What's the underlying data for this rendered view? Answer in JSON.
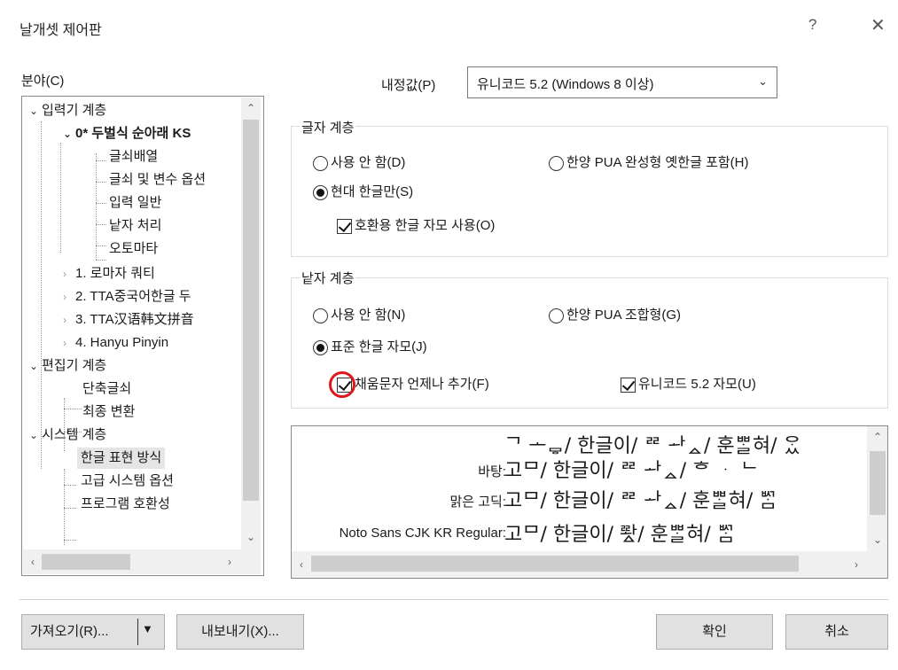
{
  "window": {
    "title": "날개셋 제어판",
    "help": "?",
    "close": "✕"
  },
  "tree": {
    "label": "분야(C)",
    "items": [
      "입력기 계층",
      "0* 두벌식 순아래 KS",
      "글쇠배열",
      "글쇠 및 변수 옵션",
      "입력 일반",
      "낱자 처리",
      "오토마타",
      "1. 로마자 쿼티",
      "2. TTA중국어한글 두",
      "3. TTA汉语韩文拼音",
      "4. Hanyu Pinyin",
      "편집기 계층",
      "단축글쇠",
      "최종 변환",
      "시스템 계층",
      "한글 표현 방식",
      "고급 시스템 옵션",
      "프로그램 호환성"
    ],
    "selected": "한글 표현 방식"
  },
  "default": {
    "label": "내정값(P)",
    "value": "유니코드 5.2 (Windows 8 이상)"
  },
  "char_layer": {
    "title": "글자 계층",
    "options": {
      "none": "사용 안 함(D)",
      "pua_full": "한양 PUA 완성형 옛한글 포함(H)",
      "modern_only": "현대 한글만(S)"
    },
    "selected": "modern_only",
    "compat_jamo": {
      "label": "호환용 한글 자모 사용(O)",
      "checked": true
    }
  },
  "jamo_layer": {
    "title": "낱자 계층",
    "options": {
      "none": "사용 안 함(N)",
      "pua_combo": "한양 PUA 조합형(G)",
      "standard": "표준 한글 자모(J)"
    },
    "selected": "standard",
    "fill_always": {
      "label": "채움문자 언제나 추가(F)",
      "checked": true
    },
    "unicode52": {
      "label": "유니코드 5.2 자모(U)",
      "checked": true
    }
  },
  "preview": {
    "rows": [
      {
        "label": "",
        "sample": "ᄀ ᅩᇢ/ 한글이/ ᄙ ᅪᇫ/ 훈ᄈᆞᆯ혀/ ᄋᆞᆻ"
      },
      {
        "label": "바탕:",
        "sample": "고ᄆ/ 한글이/ ᄙ    ᅪᇫ/ ᄒ ᆞ ᄂ"
      },
      {
        "label": "맑은 고딕:",
        "sample": "고ᄆ/ 한글이/ ᄙ ᅪᇫ/ 훈ᄈᆞᆯ혀/ ᄢᆞᆷ"
      },
      {
        "label": "Noto Sans CJK KR Regular:",
        "sample": "고ᄆ/ 한글이/ ᄙᅪᇫ/ 훈ᄈᆞᆯ혀/ ᄢᆞᆷ"
      }
    ]
  },
  "buttons": {
    "import": "가져오기(R)...",
    "export": "내보내기(X)...",
    "ok": "확인",
    "cancel": "취소"
  }
}
